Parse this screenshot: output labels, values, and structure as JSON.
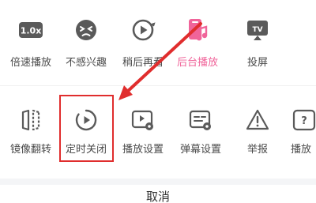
{
  "panel": {
    "row1": [
      {
        "label": "倍速播放",
        "icon": "speed-1.0x-icon",
        "badge": "1.0x"
      },
      {
        "label": "不感兴趣",
        "icon": "not-interested-face-icon"
      },
      {
        "label": "稍后再看",
        "icon": "watch-later-icon"
      },
      {
        "label": "后台播放",
        "icon": "background-play-icon"
      },
      {
        "label": "投屏",
        "icon": "cast-tv-icon",
        "badge": "TV"
      }
    ],
    "row2": [
      {
        "label": "镜像翻转",
        "icon": "mirror-flip-icon"
      },
      {
        "label": "定时关闭",
        "icon": "timer-close-icon"
      },
      {
        "label": "播放设置",
        "icon": "playback-settings-icon"
      },
      {
        "label": "弹幕设置",
        "icon": "danmaku-settings-icon"
      },
      {
        "label": "举报",
        "icon": "report-warning-icon"
      },
      {
        "label": "播放",
        "icon": "help-icon",
        "badge": "?"
      }
    ],
    "cancel_label": "取消"
  },
  "colors": {
    "accent_pink": "#f0649a",
    "icon_gray": "#5a5a5a",
    "annotation_red": "#e02d2d"
  }
}
